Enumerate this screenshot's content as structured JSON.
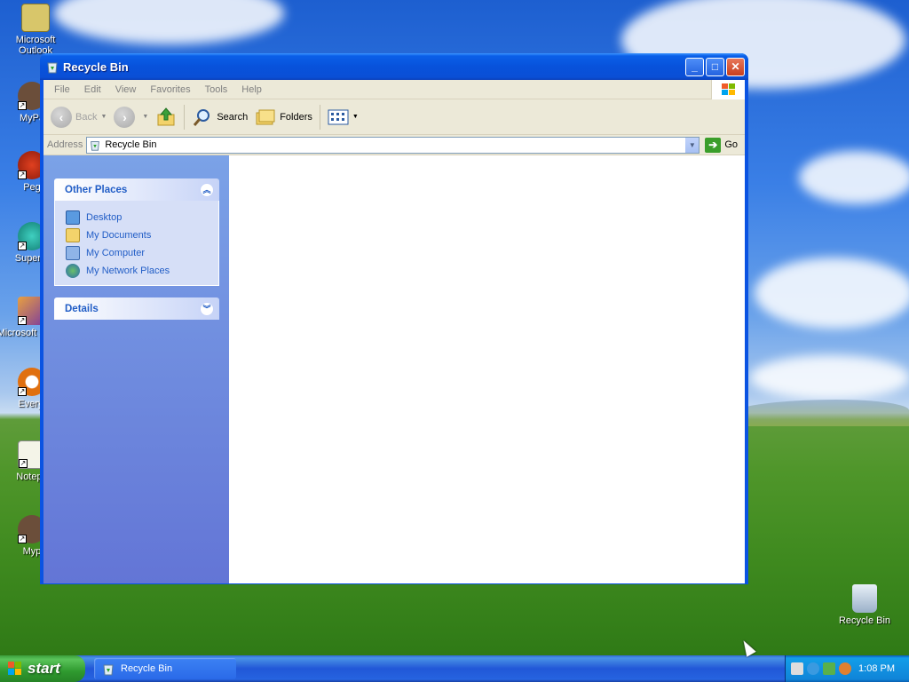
{
  "desktop": {
    "icons": [
      {
        "label": "Microsoft Outlook",
        "icon": "outlook-icon"
      },
      {
        "label": "MyPa",
        "icon": "users-icon"
      },
      {
        "label": "Peg",
        "icon": "game-icon"
      },
      {
        "label": "Superm",
        "icon": "app-icon"
      },
      {
        "label": "Microsoft Studio",
        "icon": "studio-icon"
      },
      {
        "label": "Everyt",
        "icon": "search-app-icon"
      },
      {
        "label": "Notepa",
        "icon": "notepad-icon"
      },
      {
        "label": "Myp",
        "icon": "users-icon"
      }
    ],
    "recycle_bin_label": "Recycle Bin"
  },
  "window": {
    "title": "Recycle Bin",
    "controls": {
      "minimize": "_",
      "maximize": "□",
      "close": "✕"
    },
    "menu": [
      "File",
      "Edit",
      "View",
      "Favorites",
      "Tools",
      "Help"
    ],
    "toolbar": {
      "back": "Back",
      "search": "Search",
      "folders": "Folders"
    },
    "address": {
      "label": "Address",
      "value": "Recycle Bin",
      "go": "Go"
    },
    "taskpane": {
      "other_places": {
        "title": "Other Places",
        "links": [
          "Desktop",
          "My Documents",
          "My Computer",
          "My Network Places"
        ]
      },
      "details": {
        "title": "Details"
      }
    }
  },
  "taskbar": {
    "start": "start",
    "task_button": "Recycle Bin",
    "clock": "1:08 PM"
  },
  "colors": {
    "title_blue": "#0a53e2",
    "link_blue": "#215dc6",
    "taskpane_top": "#7ba2e7",
    "taskpane_bottom": "#6375d6",
    "start_green": "#2f9a2f"
  }
}
